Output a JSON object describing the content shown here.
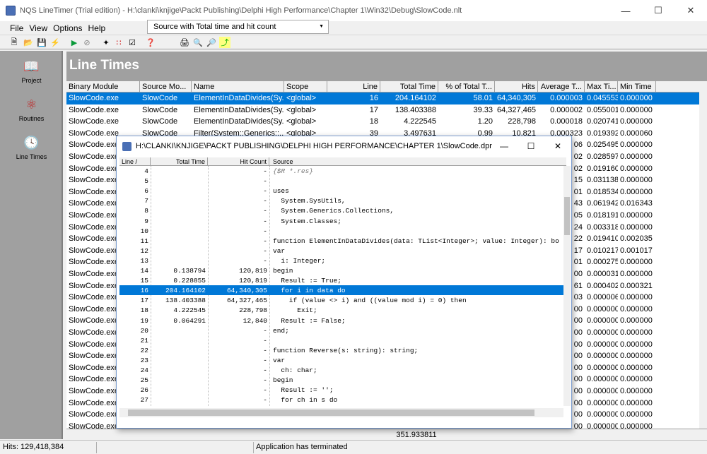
{
  "window": {
    "title": "NQS LineTimer (Trial edition) - H:\\clanki\\knjige\\Packt Publishing\\Delphi High Performance\\Chapter 1\\Win32\\Debug\\SlowCode.nlt"
  },
  "menu": [
    "File",
    "View",
    "Options",
    "Help"
  ],
  "view_select": {
    "value": "Source with Total time and hit count"
  },
  "sidebar": {
    "items": [
      {
        "label": "Project",
        "icon": "book-icon"
      },
      {
        "label": "Routines",
        "icon": "molecule-icon"
      },
      {
        "label": "Line Times",
        "icon": "clock-icon"
      }
    ]
  },
  "banner": {
    "title": "Line Times"
  },
  "grid": {
    "columns": [
      "Binary Module",
      "Source Mo...",
      "Name",
      "Scope",
      "Line",
      "Total Time",
      "% of Total T...",
      "Hits",
      "Average T...",
      "Max Ti...",
      "Min Time"
    ],
    "rows": [
      [
        "SlowCode.exe",
        "SlowCode",
        "ElementInDataDivides(Sy...",
        "<global>",
        "16",
        "204.164102",
        "58.01",
        "64,340,305",
        "0.000003",
        "0.045553",
        "0.000000"
      ],
      [
        "SlowCode.exe",
        "SlowCode",
        "ElementInDataDivides(Sy...",
        "<global>",
        "17",
        "138.403388",
        "39.33",
        "64,327,465",
        "0.000002",
        "0.055001",
        "0.000000"
      ],
      [
        "SlowCode.exe",
        "SlowCode",
        "ElementInDataDivides(Sy...",
        "<global>",
        "18",
        "4.222545",
        "1.20",
        "228,798",
        "0.000018",
        "0.020741",
        "0.000000"
      ],
      [
        "SlowCode.exe",
        "SlowCode",
        "Filter(System::Generics::...",
        "<global>",
        "39",
        "3.497631",
        "0.99",
        "10,821",
        "0.000323",
        "0.019392",
        "0.000060"
      ],
      [
        "SlowCode.exe",
        "",
        "",
        "",
        "",
        "",
        "",
        "",
        "06",
        "0.025495",
        "0.000000"
      ],
      [
        "SlowCode.exe",
        "",
        "",
        "",
        "",
        "",
        "",
        "",
        "02",
        "0.028597",
        "0.000000"
      ],
      [
        "SlowCode.exe",
        "",
        "",
        "",
        "",
        "",
        "",
        "",
        "02",
        "0.019160",
        "0.000000"
      ],
      [
        "SlowCode.exe",
        "",
        "",
        "",
        "",
        "",
        "",
        "",
        "15",
        "0.031138",
        "0.000000"
      ],
      [
        "SlowCode.exe",
        "",
        "",
        "",
        "",
        "",
        "",
        "",
        "01",
        "0.018534",
        "0.000000"
      ],
      [
        "SlowCode.exe",
        "",
        "",
        "",
        "",
        "",
        "",
        "",
        "43",
        "0.061942",
        "0.016343"
      ],
      [
        "SlowCode.exe",
        "",
        "",
        "",
        "",
        "",
        "",
        "",
        "05",
        "0.018191",
        "0.000000"
      ],
      [
        "SlowCode.exe",
        "",
        "",
        "",
        "",
        "",
        "",
        "",
        "24",
        "0.003318",
        "0.000000"
      ],
      [
        "SlowCode.exe",
        "",
        "",
        "",
        "",
        "",
        "",
        "",
        "22",
        "0.019410",
        "0.002035"
      ],
      [
        "SlowCode.exe",
        "",
        "",
        "",
        "",
        "",
        "",
        "",
        "17",
        "0.010217",
        "0.001017"
      ],
      [
        "SlowCode.exe",
        "",
        "",
        "",
        "",
        "",
        "",
        "",
        "01",
        "0.000275",
        "0.000000"
      ],
      [
        "SlowCode.exe",
        "",
        "",
        "",
        "",
        "",
        "",
        "",
        "00",
        "0.000031",
        "0.000000"
      ],
      [
        "SlowCode.exe",
        "",
        "",
        "",
        "",
        "",
        "",
        "",
        "61",
        "0.000402",
        "0.000321"
      ],
      [
        "SlowCode.exe",
        "",
        "",
        "",
        "",
        "",
        "",
        "",
        "03",
        "0.000006",
        "0.000000"
      ],
      [
        "SlowCode.exe",
        "",
        "",
        "",
        "",
        "",
        "",
        "",
        "00",
        "0.000000",
        "0.000000"
      ],
      [
        "SlowCode.exe",
        "",
        "",
        "",
        "",
        "",
        "",
        "",
        "00",
        "0.000000",
        "0.000000"
      ],
      [
        "SlowCode.exe",
        "",
        "",
        "",
        "",
        "",
        "",
        "",
        "00",
        "0.000000",
        "0.000000"
      ],
      [
        "SlowCode.exe",
        "",
        "",
        "",
        "",
        "",
        "",
        "",
        "00",
        "0.000000",
        "0.000000"
      ],
      [
        "SlowCode.exe",
        "",
        "",
        "",
        "",
        "",
        "",
        "",
        "00",
        "0.000000",
        "0.000000"
      ],
      [
        "SlowCode.exe",
        "",
        "",
        "",
        "",
        "",
        "",
        "",
        "00",
        "0.000000",
        "0.000000"
      ],
      [
        "SlowCode.exe",
        "",
        "",
        "",
        "",
        "",
        "",
        "",
        "00",
        "0.000000",
        "0.000000"
      ],
      [
        "SlowCode.exe",
        "",
        "",
        "",
        "",
        "",
        "",
        "",
        "00",
        "0.000000",
        "0.000000"
      ],
      [
        "SlowCode.exe",
        "",
        "",
        "",
        "",
        "",
        "",
        "",
        "00",
        "0.000000",
        "0.000000"
      ],
      [
        "SlowCode.exe",
        "",
        "",
        "",
        "",
        "",
        "",
        "",
        "00",
        "0.000000",
        "0.000000"
      ],
      [
        "SlowCode.exe",
        "",
        "",
        "",
        "",
        "",
        "",
        "",
        "00",
        "0.000000",
        "0.000000"
      ]
    ],
    "total": "351.933811"
  },
  "status": {
    "hits": "Hits: 129,418,384",
    "message": "Application has terminated"
  },
  "dialog": {
    "title": "H:\\CLANKI\\KNJIGE\\PACKT PUBLISHING\\DELPHI HIGH PERFORMANCE\\CHAPTER 1\\SlowCode.dpr",
    "columns": [
      "Line /",
      "Total Time",
      "Hit Count",
      "Source"
    ],
    "rows": [
      {
        "line": "4",
        "time": "",
        "hits": "-",
        "src": "{$R *.res}",
        "comment": true
      },
      {
        "line": "5",
        "time": "",
        "hits": "-",
        "src": ""
      },
      {
        "line": "6",
        "time": "",
        "hits": "-",
        "src": "uses"
      },
      {
        "line": "7",
        "time": "",
        "hits": "-",
        "src": "  System.SysUtils,"
      },
      {
        "line": "8",
        "time": "",
        "hits": "-",
        "src": "  System.Generics.Collections,"
      },
      {
        "line": "9",
        "time": "",
        "hits": "-",
        "src": "  System.Classes;"
      },
      {
        "line": "10",
        "time": "",
        "hits": "-",
        "src": ""
      },
      {
        "line": "11",
        "time": "",
        "hits": "-",
        "src": "function ElementInDataDivides(data: TList<Integer>; value: Integer): bo"
      },
      {
        "line": "12",
        "time": "",
        "hits": "-",
        "src": "var"
      },
      {
        "line": "13",
        "time": "",
        "hits": "-",
        "src": "  i: Integer;"
      },
      {
        "line": "14",
        "time": "0.138794",
        "hits": "120,819",
        "src": "begin"
      },
      {
        "line": "15",
        "time": "0.228855",
        "hits": "120,819",
        "src": "  Result := True;"
      },
      {
        "line": "16",
        "time": "204.164102",
        "hits": "64,340,305",
        "src": "  for i in data do",
        "selected": true
      },
      {
        "line": "17",
        "time": "138.403388",
        "hits": "64,327,465",
        "src": "    if (value <> i) and ((value mod i) = 0) then"
      },
      {
        "line": "18",
        "time": "4.222545",
        "hits": "228,798",
        "src": "      Exit;"
      },
      {
        "line": "19",
        "time": "0.064291",
        "hits": "12,840",
        "src": "  Result := False;"
      },
      {
        "line": "20",
        "time": "",
        "hits": "-",
        "src": "end;"
      },
      {
        "line": "21",
        "time": "",
        "hits": "-",
        "src": ""
      },
      {
        "line": "22",
        "time": "",
        "hits": "-",
        "src": "function Reverse(s: string): string;"
      },
      {
        "line": "23",
        "time": "",
        "hits": "-",
        "src": "var"
      },
      {
        "line": "24",
        "time": "",
        "hits": "-",
        "src": "  ch: char;"
      },
      {
        "line": "25",
        "time": "",
        "hits": "-",
        "src": "begin"
      },
      {
        "line": "26",
        "time": "",
        "hits": "-",
        "src": "  Result := '';"
      },
      {
        "line": "27",
        "time": "",
        "hits": "-",
        "src": "  for ch in s do"
      }
    ]
  }
}
